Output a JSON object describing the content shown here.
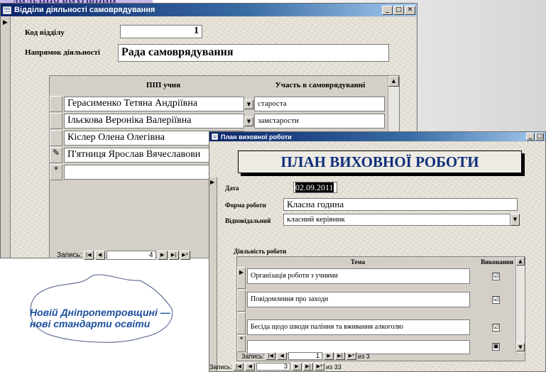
{
  "slide": {
    "header_partial": "....ДИЛЕННЯ ВИХОВНИЙ",
    "logo_line1": "Новій Дніпропетровщині —",
    "logo_line2": "нові стандарти освіти"
  },
  "win1": {
    "title": "Відділи діяльності самоврядування",
    "code_label": "Код відділу",
    "code_value": "1",
    "direction_label": "Напрямок діяльності",
    "direction_value": "Рада самоврядування",
    "columns": [
      "ПІП учня",
      "Участь в самоврядуванні"
    ],
    "rows": [
      {
        "selector": "",
        "name": "Герасименко Тетяна Андріївна",
        "role": "староста"
      },
      {
        "selector": "",
        "name": "Ільєкова Вероніка Валеріївна",
        "role": "замстарости"
      },
      {
        "selector": "",
        "name": "Кіслер Олена Олегівна",
        "role": ""
      },
      {
        "selector": "✎",
        "name": "П'ятниця Ярослав Вячеславови",
        "role": ""
      },
      {
        "selector": "*",
        "name": "",
        "role": ""
      }
    ],
    "nav": {
      "label": "Запись:",
      "current": "4"
    }
  },
  "win2": {
    "title": "План виховної роботи",
    "banner": "ПЛАН ВИХОВНОЇ РОБОТИ",
    "date_label": "Дата",
    "date_value": "02.09.2011",
    "form_label": "Форма роботи",
    "form_value": "Класна година",
    "resp_label": "Відповідальний",
    "resp_value": "класний керівник",
    "activity_label": "Діяльність роботи",
    "columns": [
      "Тема",
      "Виконання"
    ],
    "rows": [
      {
        "selector": "▶",
        "topic": "Організація роботи з учнями",
        "done": "☑"
      },
      {
        "selector": "",
        "topic": "Повідомлення про заходи",
        "done": "☑"
      },
      {
        "selector": "",
        "topic": "Бесіда щодо шкоди паління та вживання алкоголю",
        "done": "☑"
      },
      {
        "selector": "*",
        "topic": "",
        "done": "▣"
      }
    ],
    "subnav": {
      "label": "Запись:",
      "current": "1",
      "total": "из 3"
    },
    "nav": {
      "label": "Запись:",
      "current": "3",
      "total": "из 33"
    }
  }
}
